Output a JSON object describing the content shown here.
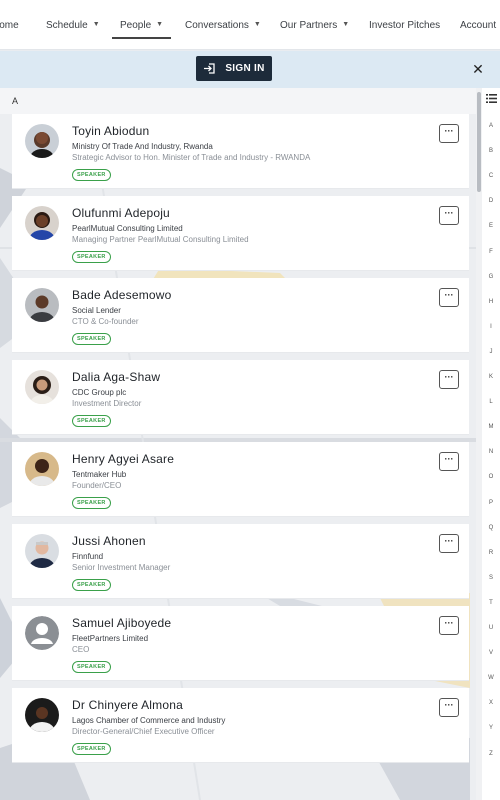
{
  "nav": {
    "items": [
      {
        "label": "Home",
        "dropdown": false
      },
      {
        "label": "Schedule",
        "dropdown": true
      },
      {
        "label": "People",
        "dropdown": true,
        "active": true
      },
      {
        "label": "Conversations",
        "dropdown": true
      },
      {
        "label": "Our Partners",
        "dropdown": true
      },
      {
        "label": "Investor Pitches",
        "dropdown": false
      },
      {
        "label": "Account",
        "dropdown": true
      }
    ]
  },
  "signin": {
    "button_label": "SIGN IN",
    "close_label": "✕"
  },
  "list": {
    "section_letter": "A",
    "more_label": "···",
    "people": [
      {
        "name": "Toyin Abiodun",
        "organization": "Ministry Of Trade And Industry, Rwanda",
        "role": "Strategic Advisor to Hon. Minister of Trade and Industry - RWANDA",
        "badge": "SPEAKER",
        "avatar": "photo-woman-1"
      },
      {
        "name": "Olufunmi Adepoju",
        "organization": "PearlMutual Consulting Limited",
        "role": "Managing Partner PearlMutual Consulting Limited",
        "badge": "SPEAKER",
        "avatar": "photo-woman-2"
      },
      {
        "name": "Bade Adesemowo",
        "organization": "Social Lender",
        "role": "CTO & Co-founder",
        "badge": "SPEAKER",
        "avatar": "photo-man-1"
      },
      {
        "name": "Dalia Aga-Shaw",
        "organization": "CDC Group plc",
        "role": "Investment Director",
        "badge": "SPEAKER",
        "avatar": "photo-woman-3"
      },
      {
        "name": "Henry Agyei Asare",
        "organization": "Tentmaker Hub",
        "role": "Founder/CEO",
        "badge": "SPEAKER",
        "avatar": "photo-man-2"
      },
      {
        "name": "Jussi Ahonen",
        "organization": "Finnfund",
        "role": "Senior Investment Manager",
        "badge": "SPEAKER",
        "avatar": "photo-man-3"
      },
      {
        "name": "Samuel Ajiboyede",
        "organization": "FleetPartners Limited",
        "role": "CEO",
        "badge": "SPEAKER",
        "avatar": "default-user-icon"
      },
      {
        "name": "Dr Chinyere Almona",
        "organization": "Lagos Chamber of Commerce and Industry",
        "role": "Director-General/Chief Executive Officer",
        "badge": "SPEAKER",
        "avatar": "photo-woman-4"
      }
    ]
  },
  "alphabet": [
    "A",
    "B",
    "C",
    "D",
    "E",
    "F",
    "G",
    "H",
    "I",
    "J",
    "K",
    "L",
    "M",
    "N",
    "O",
    "P",
    "Q",
    "R",
    "S",
    "T",
    "U",
    "V",
    "W",
    "X",
    "Y",
    "Z"
  ],
  "colors": {
    "signin_button": "#1d2b3a",
    "signin_bar": "#dce9f3",
    "badge_green": "#3aa04a"
  }
}
